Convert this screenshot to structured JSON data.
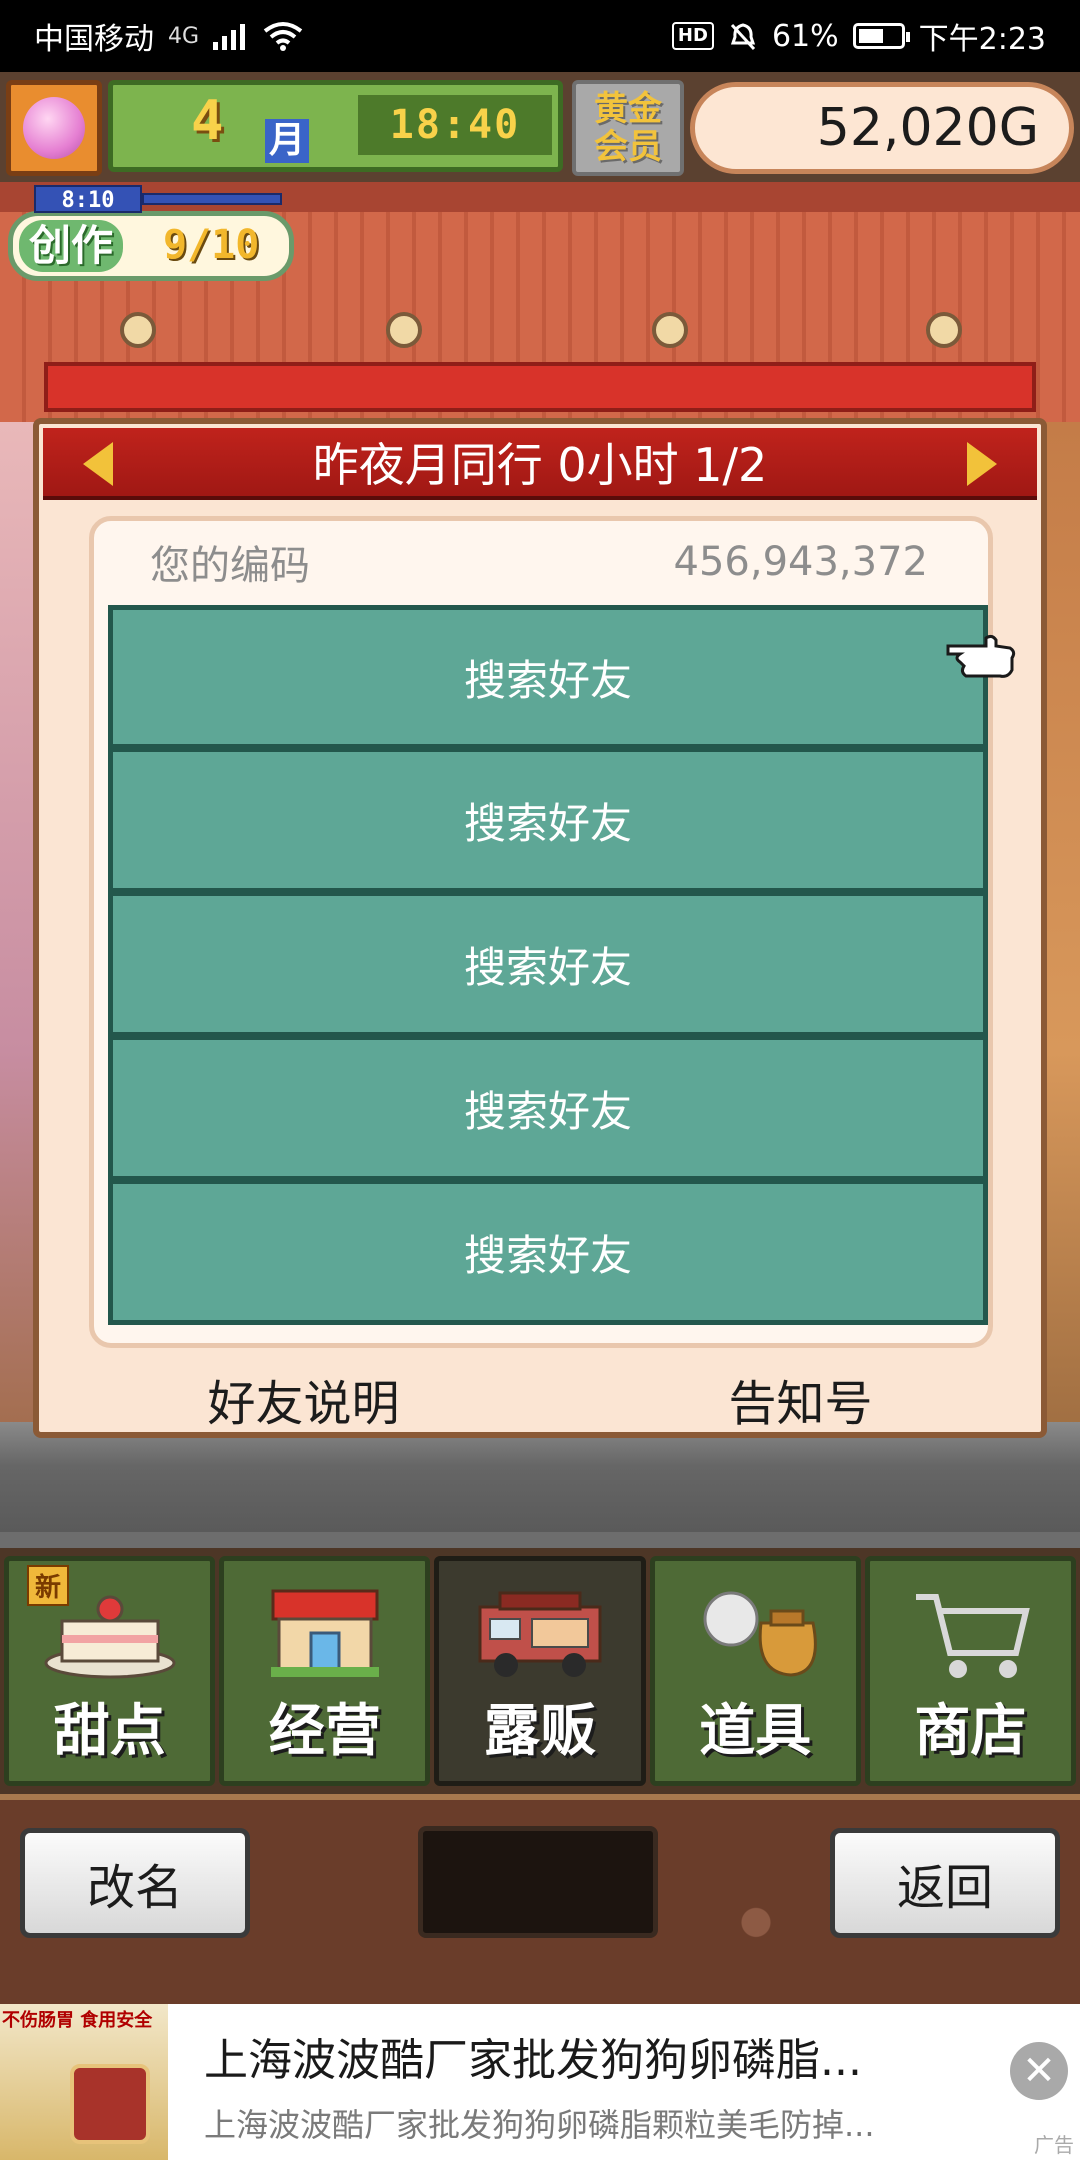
{
  "status_bar": {
    "carrier": "中国移动",
    "network": "4G",
    "hd": "HD",
    "battery_percent": "61%",
    "battery_level": 0.61,
    "time": "下午2:23"
  },
  "hud": {
    "month_num": "4",
    "month_unit": "月",
    "clock": "18:40",
    "member_badge": "黄金\n会员",
    "money": "52,020G"
  },
  "create": {
    "timer": "8:10",
    "label": "创作",
    "count": "9/10"
  },
  "dialog": {
    "title": "昨夜月同行  0小时 1/2",
    "code_label": "您的编码",
    "code_value": "456,943,372",
    "friend_slots": [
      "搜索好友",
      "搜索好友",
      "搜索好友",
      "搜索好友",
      "搜索好友"
    ],
    "footer_left": "好友说明",
    "footer_right": "告知号"
  },
  "menu": {
    "new_badge": "新",
    "items": [
      {
        "label": "甜点",
        "icon": "cake-icon"
      },
      {
        "label": "经营",
        "icon": "shop-icon"
      },
      {
        "label": "露贩",
        "icon": "food-truck-icon"
      },
      {
        "label": "道具",
        "icon": "items-bag-icon"
      },
      {
        "label": "商店",
        "icon": "shopping-cart-icon"
      }
    ]
  },
  "bottom": {
    "rename": "改名",
    "back": "返回"
  },
  "ad": {
    "thumb_text": "不伤肠胃 食用安全",
    "title": "上海波波酷厂家批发狗狗卵磷脂...",
    "subtitle": "上海波波酷厂家批发狗狗卵磷脂颗粒美毛防掉...",
    "close": "✕",
    "tag": "广告"
  },
  "colors": {
    "title_red": "#c0231c",
    "friend_teal": "#5ea796",
    "menu_green": "#4e6a36",
    "money_bg": "#fde6d3"
  }
}
